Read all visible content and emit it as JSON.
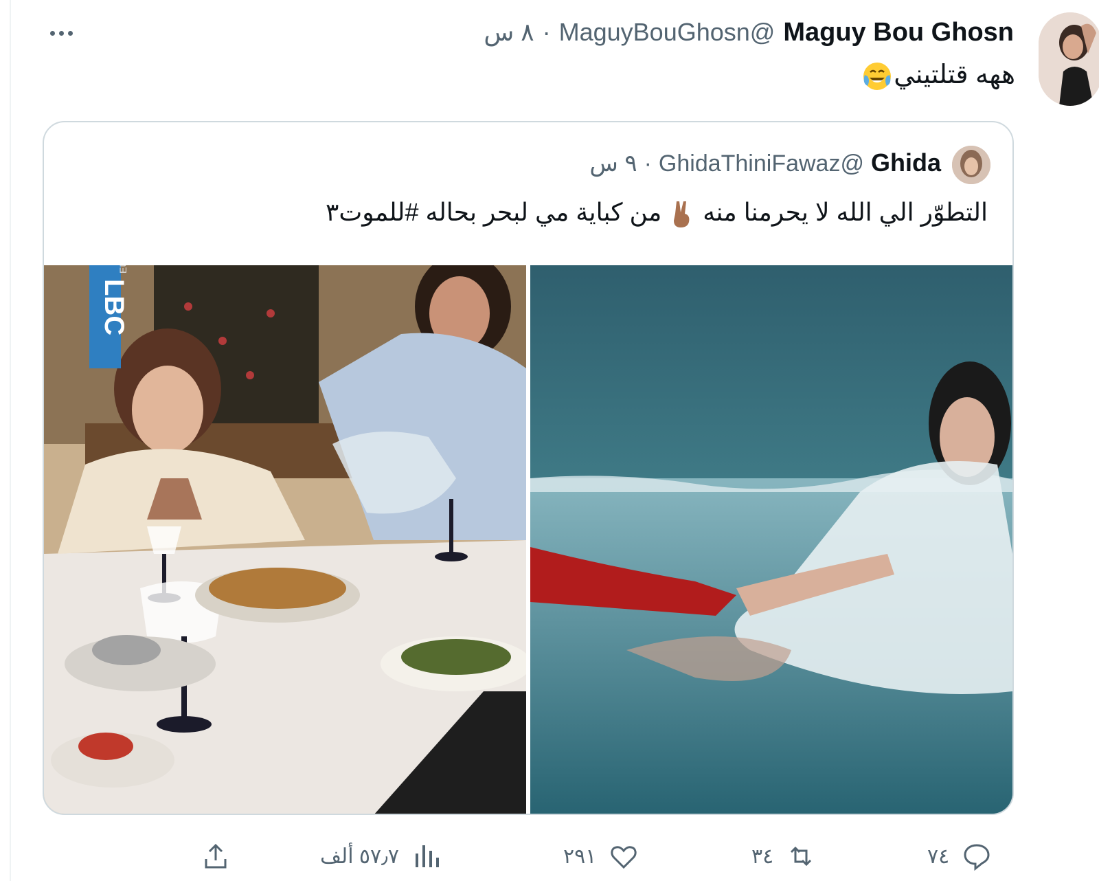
{
  "tweet": {
    "author": {
      "display_name": "Maguy Bou Ghosn",
      "handle": "@MaguyBouGhosn",
      "separator": "·",
      "time": "٨ س"
    },
    "text": "ههه قتلتيني",
    "emoji": "face-with-tears-of-joy"
  },
  "quoted": {
    "author": {
      "display_name": "Ghida",
      "handle": "@GhidaThiniFawaz",
      "separator": "·",
      "time": "٩ س"
    },
    "text_part1": "التطوّر الي الله لا يحرمنا منه",
    "text_part2": "من كباية مي لبحر بحاله #للموت٣",
    "emoji": "victory-hand",
    "media": {
      "left_watermark_main": "LBC",
      "left_watermark_sub": "EUROPE"
    }
  },
  "actions": {
    "reply_count": "٧٤",
    "retweet_count": "٣٤",
    "like_count": "٢٩١",
    "views_count": "٥٧٫٧ ألف"
  },
  "colors": {
    "text_primary": "#0f1419",
    "text_secondary": "#536471",
    "border": "#cfd9de"
  }
}
